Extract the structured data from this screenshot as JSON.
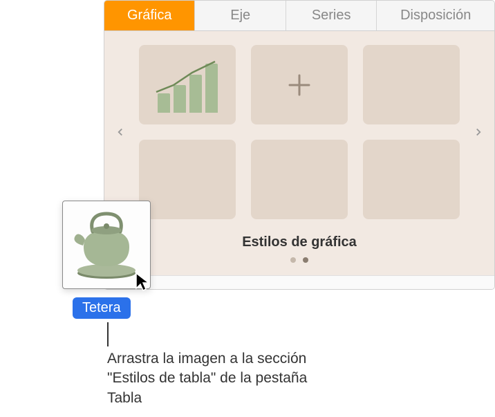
{
  "tabs": {
    "grafica": "Gráfica",
    "eje": "Eje",
    "series": "Series",
    "disposicion": "Disposición"
  },
  "styles": {
    "caption": "Estilos de gráfica"
  },
  "drag": {
    "label": "Tetera"
  },
  "callout": {
    "text": "Arrastra la imagen a la sección \"Estilos de tabla\" de la pestaña Tabla"
  }
}
